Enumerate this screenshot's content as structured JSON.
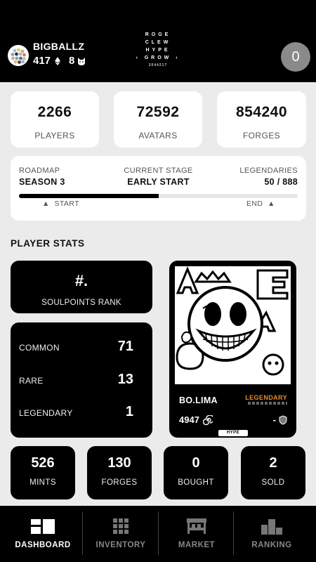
{
  "header": {
    "username": "BIGBALLZ",
    "balance_primary": "417",
    "balance_secondary": "8",
    "logo_lines": [
      "ROGE",
      "CLEW",
      "HYPE",
      "GROW"
    ],
    "logo_sub": "2044217",
    "notification_count": "0"
  },
  "stats": [
    {
      "value": "2266",
      "label": "PLAYERS"
    },
    {
      "value": "72592",
      "label": "AVATARS"
    },
    {
      "value": "854240",
      "label": "FORGES"
    }
  ],
  "roadmap": {
    "roadmap_title": "ROADMAP",
    "roadmap_value": "SEASON 3",
    "stage_title": "CURRENT STAGE",
    "stage_value": "EARLY START",
    "legendaries_title": "LEGENDARIES",
    "legendaries_value": "50 / 888",
    "progress_fraction": 0.5,
    "start_label": "START",
    "end_label": "END"
  },
  "player_stats": {
    "title": "PLAYER STATS",
    "rank_value": "#.",
    "rank_label": "SOULPOINTS RANK",
    "rarities": [
      {
        "label": "COMMON",
        "value": "71"
      },
      {
        "label": "RARE",
        "value": "13"
      },
      {
        "label": "LEGENDARY",
        "value": "1"
      }
    ],
    "totals": [
      {
        "value": "526",
        "label": "MINTS"
      },
      {
        "value": "130",
        "label": "FORGES"
      },
      {
        "value": "0",
        "label": "BOUGHT"
      },
      {
        "value": "2",
        "label": "SOLD"
      }
    ]
  },
  "featured": {
    "name": "BO.LIMA",
    "rarity": "LEGENDARY",
    "score": "4947",
    "right_value": "-",
    "tag": "HYPE"
  },
  "nav": {
    "items": [
      {
        "label": "DASHBOARD",
        "icon": "dashboard-icon"
      },
      {
        "label": "INVENTORY",
        "icon": "grid-icon"
      },
      {
        "label": "MARKET",
        "icon": "market-icon"
      },
      {
        "label": "RANKING",
        "icon": "podium-icon"
      }
    ],
    "active": "DASHBOARD"
  },
  "colors": {
    "accent_legendary": "#e88b2c",
    "background": "#ebebeb",
    "dark": "#000000"
  }
}
